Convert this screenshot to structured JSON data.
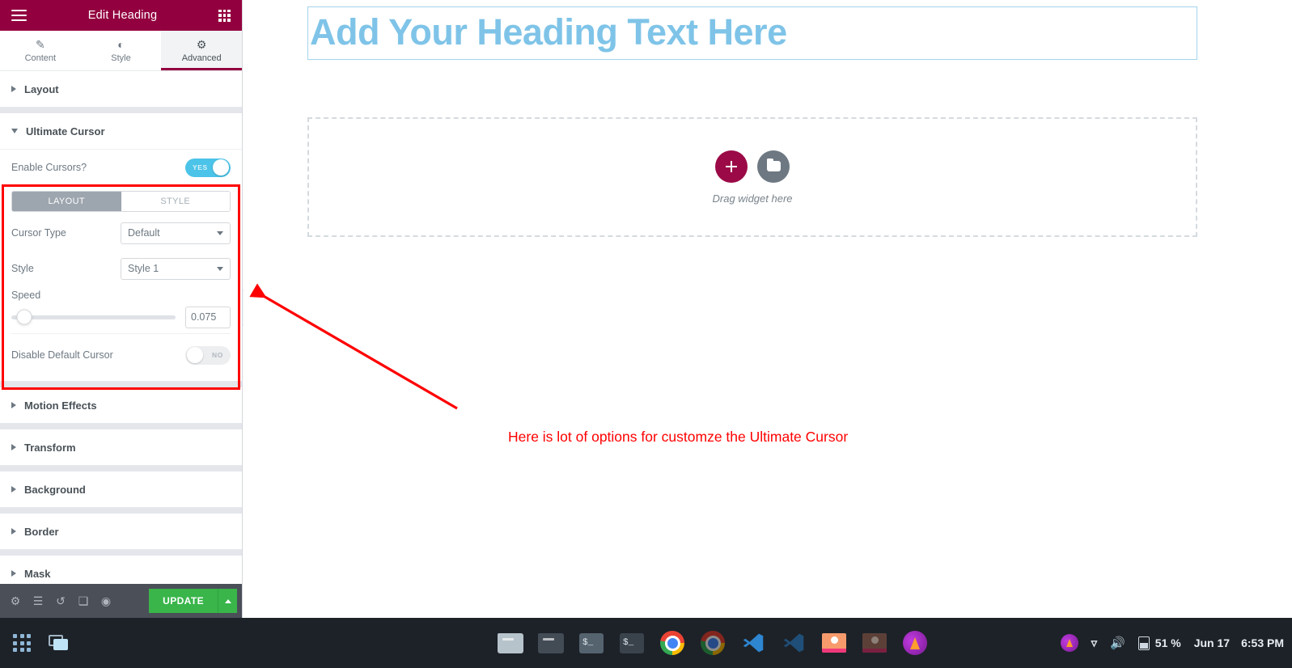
{
  "panel": {
    "header": {
      "menu_icon": "hamburger-icon",
      "title": "Edit Heading",
      "apps_icon": "grid-apps-icon"
    },
    "tabs": [
      {
        "label": "Content",
        "icon": "pencil-icon",
        "glyph": "✎",
        "active": false
      },
      {
        "label": "Style",
        "icon": "contrast-icon",
        "glyph": "◐",
        "active": false
      },
      {
        "label": "Advanced",
        "icon": "gear-icon",
        "glyph": "⚙",
        "active": true
      }
    ],
    "sections": [
      {
        "label": "Layout",
        "open": false
      },
      {
        "label": "Ultimate Cursor",
        "open": true
      },
      {
        "label": "Motion Effects",
        "open": false
      },
      {
        "label": "Transform",
        "open": false
      },
      {
        "label": "Background",
        "open": false
      },
      {
        "label": "Border",
        "open": false
      },
      {
        "label": "Mask",
        "open": false
      }
    ],
    "ultimate_cursor": {
      "enable_cursors_label": "Enable Cursors?",
      "enable_cursors_value": "YES",
      "choice_tabs": [
        {
          "label": "LAYOUT",
          "active": true
        },
        {
          "label": "STYLE",
          "active": false
        }
      ],
      "cursor_type_label": "Cursor Type",
      "cursor_type_value": "Default",
      "style_label": "Style",
      "style_value": "Style 1",
      "speed_label": "Speed",
      "speed_value": "0.075",
      "speed_percent": 8,
      "disable_default_label": "Disable Default Cursor",
      "disable_default_value": "NO"
    },
    "footer": {
      "icons": [
        {
          "name": "settings-gear-icon",
          "glyph": "⚙"
        },
        {
          "name": "navigator-layers-icon",
          "glyph": "☰"
        },
        {
          "name": "history-icon",
          "glyph": "↺"
        },
        {
          "name": "responsive-mode-icon",
          "glyph": "❑"
        },
        {
          "name": "preview-eye-icon",
          "glyph": "◉"
        }
      ],
      "update_label": "UPDATE"
    },
    "collapse_handle": "❮"
  },
  "canvas": {
    "heading_text": "Add Your Heading Text Here",
    "drop_zone_text": "Drag widget here",
    "add_section_icon": "plus-icon",
    "template_icon": "folder-icon",
    "annotation_text": "Here is lot of options for customze the Ultimate Cursor"
  },
  "taskbar": {
    "apps_button": "app-launcher-icon",
    "workspace_button": "window-switcher-icon",
    "items": [
      {
        "name": "file-manager",
        "type": "folder",
        "active": true
      },
      {
        "name": "file-manager-2",
        "type": "folder",
        "active": false
      },
      {
        "name": "terminal",
        "type": "terminal",
        "active": true
      },
      {
        "name": "terminal-2",
        "type": "terminal",
        "active": false
      },
      {
        "name": "chrome",
        "type": "chrome",
        "active": true
      },
      {
        "name": "chrome-2",
        "type": "chrome",
        "active": false
      },
      {
        "name": "vscode",
        "type": "vscode",
        "active": true
      },
      {
        "name": "vscode-2",
        "type": "vscode",
        "active": false
      },
      {
        "name": "image-viewer",
        "type": "image",
        "active": true
      },
      {
        "name": "image-viewer-2",
        "type": "image",
        "active": false
      },
      {
        "name": "firefox",
        "type": "fire",
        "active": false
      }
    ],
    "tray": {
      "notify_icon": "flame-notification-icon",
      "wifi_icon": "wifi-icon",
      "volume_icon": "volume-icon",
      "battery_icon": "battery-charging-icon",
      "battery_percent": "51 %",
      "date": "Jun 17",
      "time": "6:53 PM"
    }
  },
  "colors": {
    "brand_magenta": "#93003f",
    "accent_cyan": "#4cc3e8",
    "update_green": "#39b54a",
    "heading_blue": "#7fc4e8",
    "annotation_red": "#ff0000"
  }
}
